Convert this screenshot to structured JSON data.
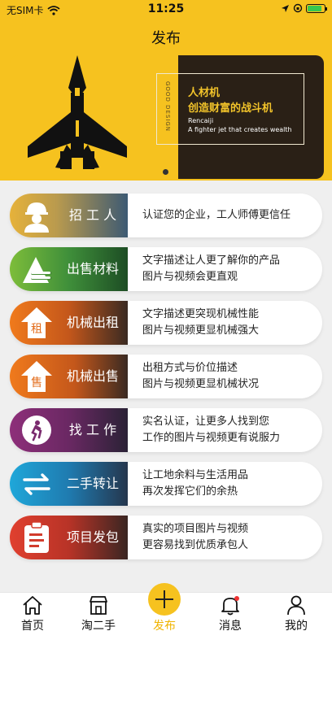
{
  "status_bar": {
    "carrier": "无SIM卡",
    "time": "11:25"
  },
  "header": {
    "title": "发布"
  },
  "banner": {
    "vertical_text": "GOOD DESIGN",
    "line1": "人材机",
    "line2": "创造财富的战斗机",
    "line3": "Rencaiji",
    "line4": "A fighter jet that creates wealth"
  },
  "colors": {
    "accent": "#f6c21f",
    "banner_dark": "#2a2016"
  },
  "items": [
    {
      "label": "招 工 人",
      "icon": "worker-icon",
      "desc1": "认证您的企业，工人师傅更信任",
      "desc2": ""
    },
    {
      "label": "出售材料",
      "icon": "materials-icon",
      "desc1": "文字描述让人更了解你的产品",
      "desc2": "图片与视频会更直观"
    },
    {
      "label": "机械出租",
      "icon": "rent-icon",
      "desc1": "文字描述更突现机械性能",
      "desc2": "图片与视频更显机械强大"
    },
    {
      "label": "机械出售",
      "icon": "sell-icon",
      "desc1": "出租方式与价位描述",
      "desc2": "图片与视频更显机械状况"
    },
    {
      "label": "找 工 作",
      "icon": "job-icon",
      "desc1": "实名认证，让更多人找到您",
      "desc2": "工作的图片与视频更有说服力"
    },
    {
      "label": "二手转让",
      "icon": "transfer-icon",
      "desc1": "让工地余料与生活用品",
      "desc2": "再次发挥它们的余热"
    },
    {
      "label": "项目发包",
      "icon": "project-icon",
      "desc1": "真实的项目图片与视频",
      "desc2": "更容易找到优质承包人"
    }
  ],
  "tabs": [
    {
      "label": "首页",
      "icon": "home-icon"
    },
    {
      "label": "淘二手",
      "icon": "shop-icon"
    },
    {
      "label": "发布",
      "icon": "plus-icon"
    },
    {
      "label": "消息",
      "icon": "bell-icon"
    },
    {
      "label": "我的",
      "icon": "profile-icon"
    }
  ]
}
